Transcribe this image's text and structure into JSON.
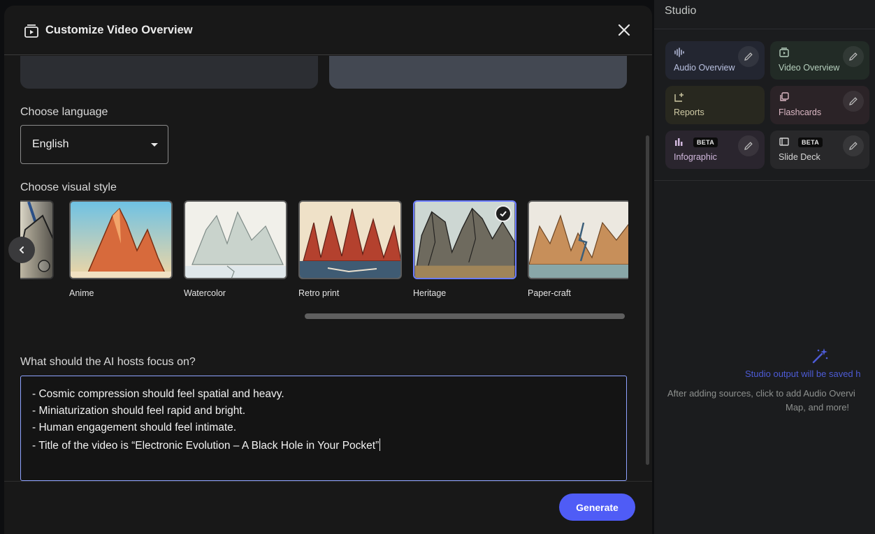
{
  "studio": {
    "title": "Studio",
    "tiles": [
      {
        "label": "Audio Overview",
        "icon": "audio-waveform-icon"
      },
      {
        "label": "Video Overview",
        "icon": "video-icon"
      },
      {
        "label": "Reports",
        "icon": "reports-icon"
      },
      {
        "label": "Flashcards",
        "icon": "flashcards-icon"
      },
      {
        "label": "Infographic",
        "icon": "infographic-icon",
        "badge": "BETA"
      },
      {
        "label": "Slide Deck",
        "icon": "slide-deck-icon",
        "badge": "BETA"
      }
    ],
    "empty_title": "Studio output will be saved h",
    "empty_text_line1": "After adding sources, click to add Audio Overvi",
    "empty_text_line2": "Map, and more!"
  },
  "dialog": {
    "title": "Customize Video Overview",
    "language_label": "Choose language",
    "language_value": "English",
    "style_label": "Choose visual style",
    "styles": [
      {
        "name": "Anime",
        "selected": false
      },
      {
        "name": "Watercolor",
        "selected": false
      },
      {
        "name": "Retro print",
        "selected": false
      },
      {
        "name": "Heritage",
        "selected": true
      },
      {
        "name": "Paper-craft",
        "selected": false
      }
    ],
    "focus_label": "What should the AI hosts focus on?",
    "focus_lines": [
      "- Cosmic compression should feel spatial and heavy.",
      "- Miniaturization should feel rapid and bright.",
      "- Human engagement should feel intimate.",
      "- Title of the video is “Electronic Evolution – A Black Hole in Your Pocket”"
    ],
    "generate_label": "Generate"
  },
  "colors": {
    "accent": "#4f5cf6",
    "selected_border": "#6b7cff",
    "background": "#181818"
  }
}
